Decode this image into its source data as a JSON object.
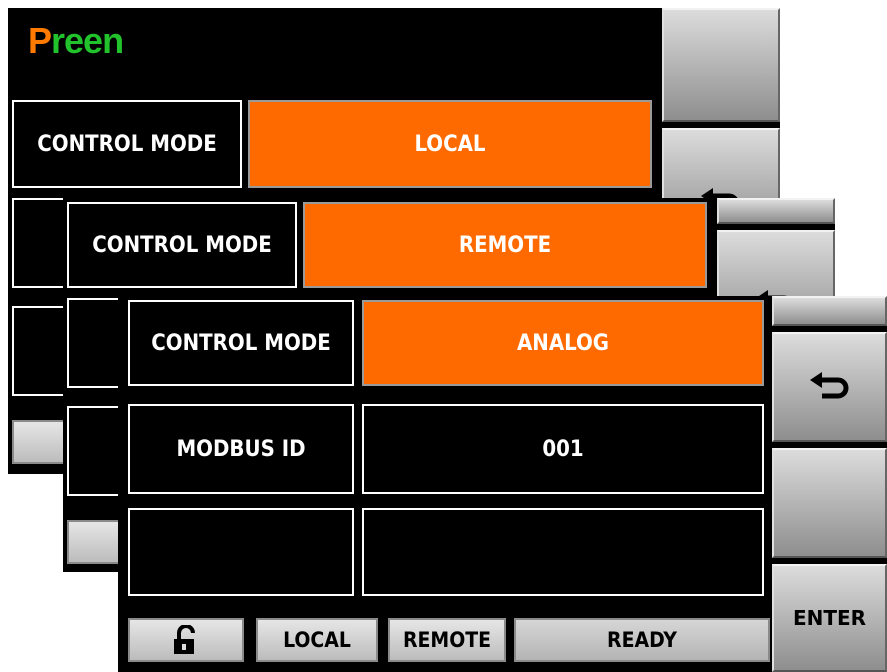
{
  "brand": {
    "first_letter": "P",
    "rest": "reen"
  },
  "screens": {
    "back": {
      "label": "CONTROL MODE",
      "value": "LOCAL"
    },
    "middle": {
      "label": "CONTROL MODE",
      "value": "REMOTE"
    },
    "front": {
      "rows": [
        {
          "label": "CONTROL MODE",
          "value": "ANALOG"
        },
        {
          "label": "MODBUS ID",
          "value": "001"
        },
        {
          "label": "",
          "value": ""
        }
      ],
      "enter_label": "ENTER",
      "bottom": {
        "local": "LOCAL",
        "remote": "REMOTE",
        "status": "READY"
      }
    }
  },
  "icons": {
    "back": "return-arrow-icon",
    "lock": "unlock-icon"
  },
  "colors": {
    "accent": "#ff6a00",
    "logo_p": "#ff7a00",
    "logo_rest": "#22c22c"
  }
}
